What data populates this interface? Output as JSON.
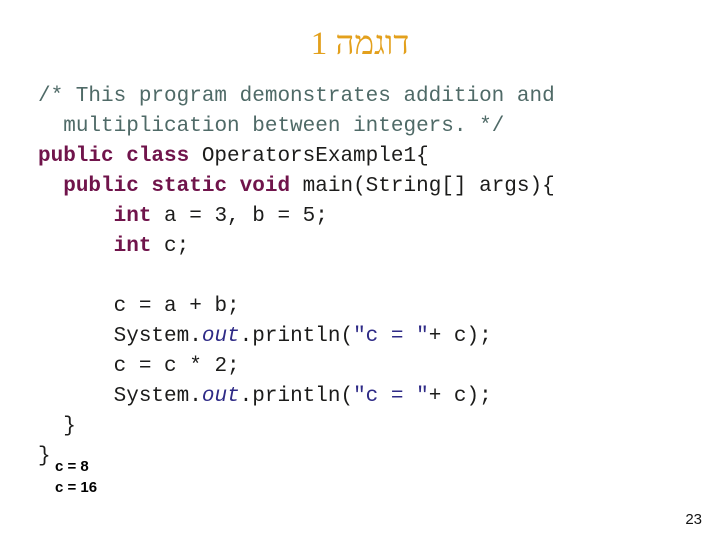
{
  "slide": {
    "title": "דוגמה 1",
    "title_color": "#E3A01C",
    "background_color": "#FFFFFF",
    "page_number": "23"
  },
  "colors": {
    "comment": "#4F6A67",
    "keyword": "#70144B",
    "plain_code": "#1C1C1B",
    "string_literal": "#2E2A86",
    "field": "#2E2A86",
    "output_text": "#000000"
  },
  "code": {
    "language": "java",
    "lines": [
      {
        "indent": 0,
        "tokens": [
          {
            "type": "comment",
            "text": "/* This program demonstrates addition and"
          }
        ]
      },
      {
        "indent": 1,
        "tokens": [
          {
            "type": "comment",
            "text": "multiplication between integers. */"
          }
        ]
      },
      {
        "indent": 0,
        "tokens": [
          {
            "type": "keyword",
            "text": "public class "
          },
          {
            "type": "plain",
            "text": "OperatorsExample1{"
          }
        ]
      },
      {
        "indent": 1,
        "tokens": [
          {
            "type": "keyword",
            "text": "public static void "
          },
          {
            "type": "plain",
            "text": "main(String[] args){"
          }
        ]
      },
      {
        "indent": 3,
        "tokens": [
          {
            "type": "keyword",
            "text": "int "
          },
          {
            "type": "plain",
            "text": "a = 3, b = 5;"
          }
        ]
      },
      {
        "indent": 3,
        "tokens": [
          {
            "type": "keyword",
            "text": "int "
          },
          {
            "type": "plain",
            "text": "c;"
          }
        ]
      },
      {
        "indent": 0,
        "blank": true,
        "tokens": []
      },
      {
        "indent": 3,
        "tokens": [
          {
            "type": "plain",
            "text": "c = a + b;"
          }
        ]
      },
      {
        "indent": 3,
        "tokens": [
          {
            "type": "plain",
            "text": "System."
          },
          {
            "type": "field",
            "text": "out"
          },
          {
            "type": "plain",
            "text": ".println("
          },
          {
            "type": "string",
            "text": "\"c = \""
          },
          {
            "type": "plain",
            "text": "+ c);"
          }
        ]
      },
      {
        "indent": 3,
        "tokens": [
          {
            "type": "plain",
            "text": "c = c * 2;"
          }
        ]
      },
      {
        "indent": 3,
        "tokens": [
          {
            "type": "plain",
            "text": "System."
          },
          {
            "type": "field",
            "text": "out"
          },
          {
            "type": "plain",
            "text": ".println("
          },
          {
            "type": "string",
            "text": "\"c = \""
          },
          {
            "type": "plain",
            "text": "+ c);"
          }
        ]
      },
      {
        "indent": 1,
        "tokens": [
          {
            "type": "plain",
            "text": "}"
          }
        ]
      },
      {
        "indent": 0,
        "tokens": [
          {
            "type": "plain",
            "text": "}"
          }
        ]
      }
    ]
  },
  "output": {
    "lines": [
      "c = 8",
      "c = 16"
    ]
  }
}
